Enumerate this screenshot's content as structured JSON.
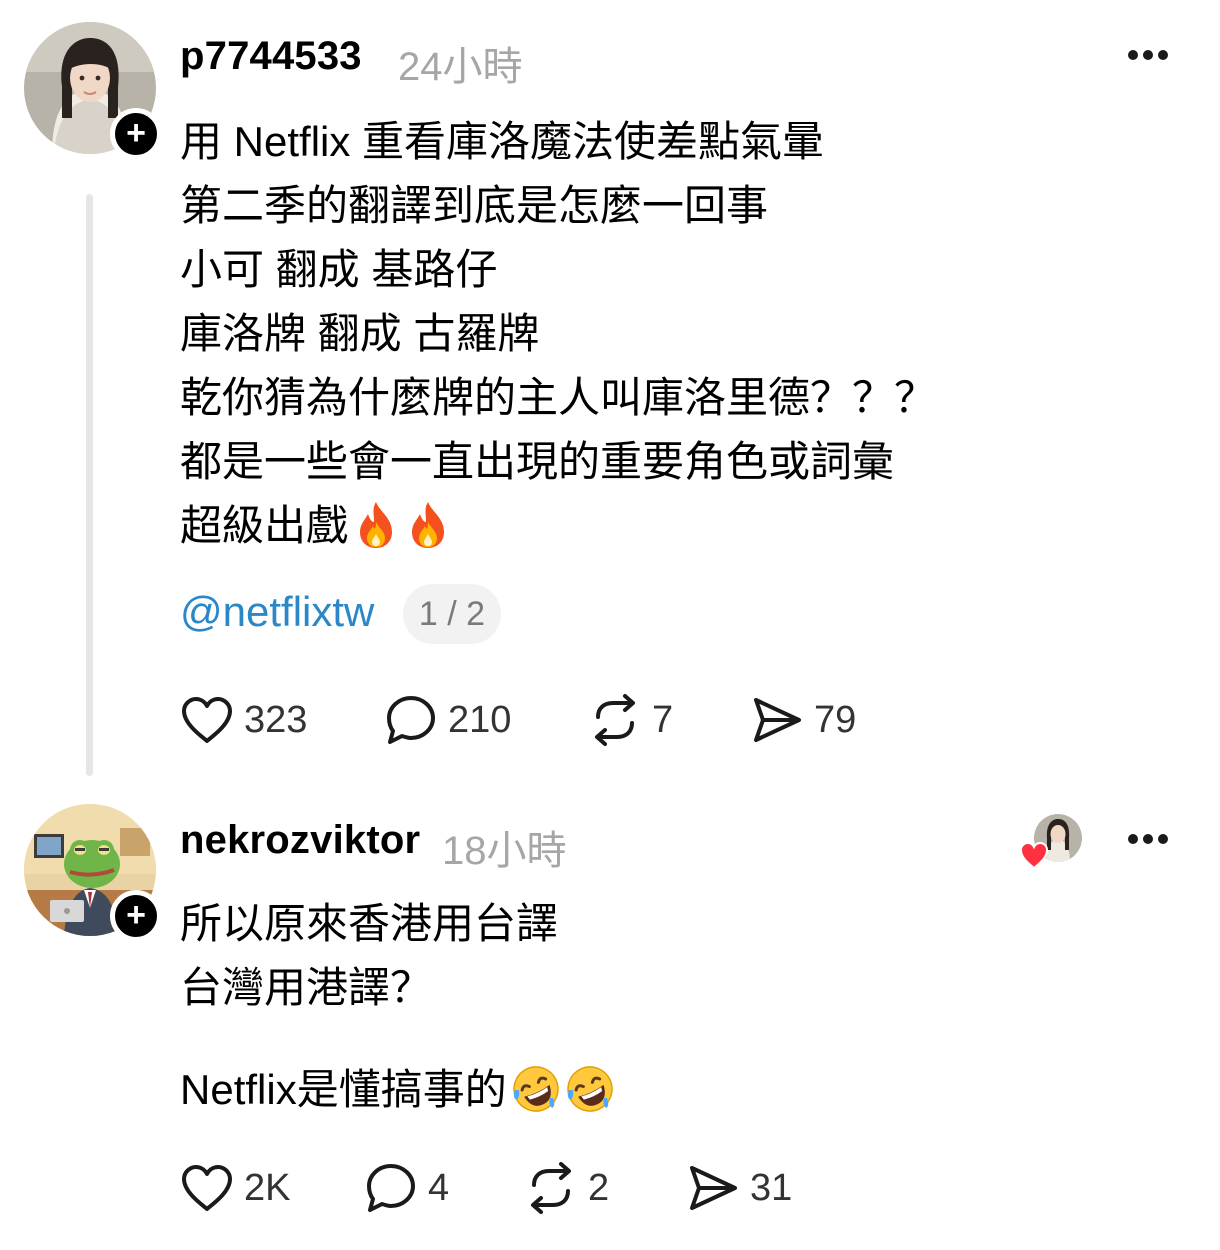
{
  "posts": [
    {
      "username": "p7744533",
      "time": "24小時",
      "lines": [
        "用 Netflix 重看庫洛魔法使差點氣暈",
        "第二季的翻譯到底是怎麼一回事",
        "小可 翻成 基路仔",
        "庫洛牌 翻成 古羅牌",
        "乾你猜為什麼牌的主人叫庫洛里德？？？",
        "都是一些會一直出現的重要角色或詞彙",
        "超級出戲"
      ],
      "trailing_emoji": [
        "fire-emoji",
        "fire-emoji"
      ],
      "mention": "@netflixtw",
      "pager": "1 / 2",
      "actions": {
        "likes": "323",
        "replies": "210",
        "reposts": "7",
        "shares": "79"
      }
    },
    {
      "username": "nekrozviktor",
      "time": "18小時",
      "lines": [
        "所以原來香港用台譯",
        "台灣用港譯？",
        "",
        "Netflix是懂搞事的"
      ],
      "trailing_emoji": [
        "rolling-laughing-emoji",
        "rolling-laughing-emoji"
      ],
      "actions": {
        "likes": "2K",
        "replies": "4",
        "reposts": "2",
        "shares": "31"
      }
    }
  ],
  "icons": {
    "follow": "plus-icon",
    "more": "more-dots-icon",
    "like": "heart-icon",
    "reply": "comment-icon",
    "repost": "repost-icon",
    "share": "send-icon"
  },
  "colors": {
    "mention": "#2a87c8",
    "timestamp": "#a6a6a6",
    "liked_heart": "#ff3040"
  }
}
